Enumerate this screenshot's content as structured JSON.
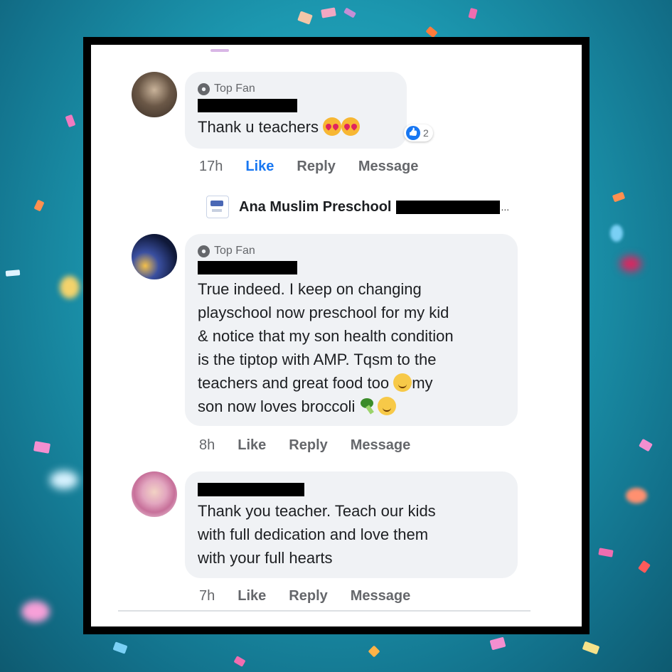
{
  "background": {
    "color": "#1c98b0"
  },
  "comments": [
    {
      "badge": "Top Fan",
      "text": "Thank u teachers",
      "reaction_count": "2",
      "time": "17h",
      "like_label": "Like",
      "reply_label": "Reply",
      "message_label": "Message",
      "liked": true
    },
    {
      "badge": "Top Fan",
      "text_lines": [
        "True indeed. I keep on changing",
        "playschool now preschool for my kid",
        "& notice that my son health condition",
        "is the tiptop with AMP. Tqsm to the",
        "teachers and great food too",
        "my",
        "son now loves broccoli"
      ],
      "time": "8h",
      "like_label": "Like",
      "reply_label": "Reply",
      "message_label": "Message"
    },
    {
      "text_lines": [
        "Thank you teacher. Teach our kids",
        "with full dedication and love them",
        "with your full hearts"
      ],
      "time": "7h",
      "like_label": "Like",
      "reply_label": "Reply",
      "message_label": "Message"
    }
  ],
  "page_reply": {
    "name": "Ana Muslim Preschool",
    "ellipsis": "..."
  },
  "icons": [
    "top-fan-badge-icon",
    "like-reaction-icon",
    "smiling-hearts-emoji-icon",
    "smiling-emoji-icon",
    "broccoli-emoji-icon",
    "page-logo-icon"
  ]
}
